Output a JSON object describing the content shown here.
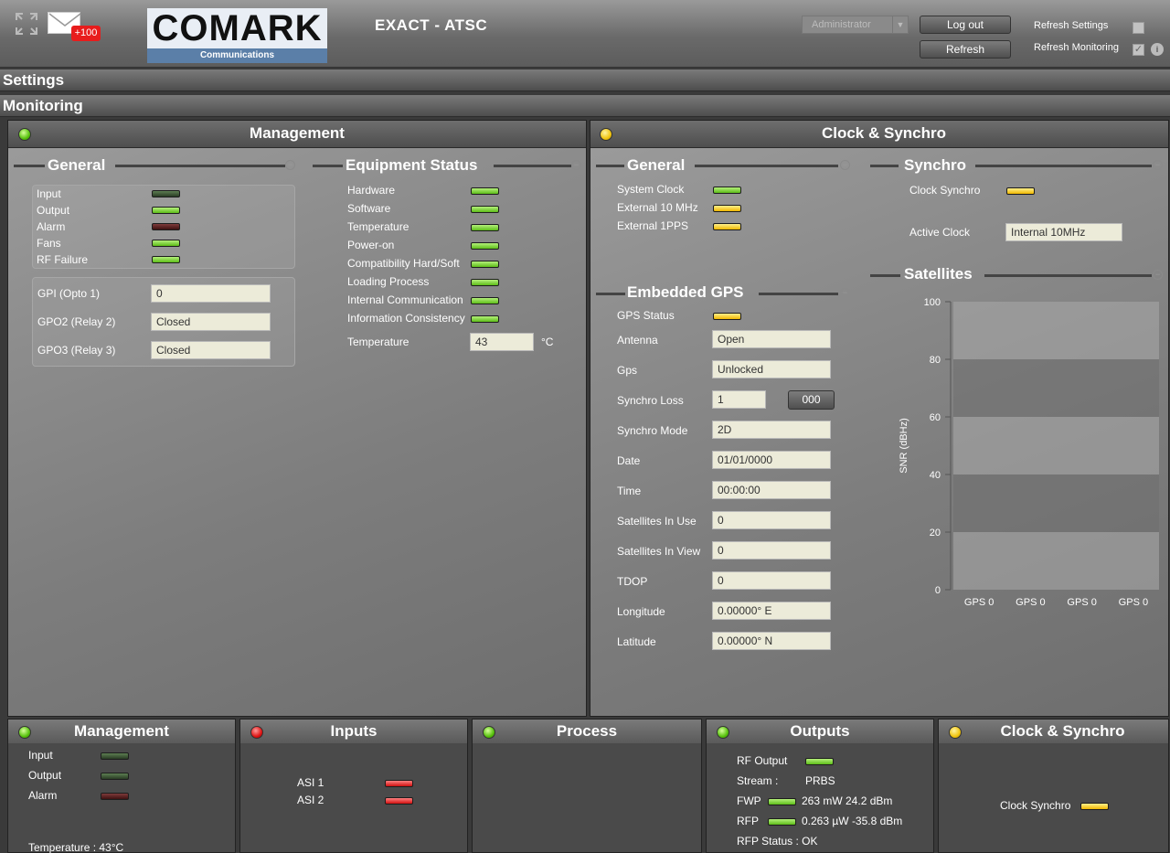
{
  "header": {
    "mail_badge": "+100",
    "logo_top": "COMARK",
    "logo_bottom": "Communications",
    "title": "EXACT  - ATSC",
    "user_role": "Administrator",
    "logout_label": "Log out",
    "refresh_label": "Refresh",
    "refresh_settings_label": "Refresh Settings",
    "refresh_monitoring_label": "Refresh Monitoring",
    "refresh_settings_checked": false,
    "refresh_monitoring_checked": true
  },
  "nav": {
    "settings": "Settings",
    "monitoring": "Monitoring"
  },
  "management": {
    "title": "Management",
    "status": "green",
    "general": {
      "title": "General",
      "indicators": [
        {
          "label": "Input",
          "state": "dark-green"
        },
        {
          "label": "Output",
          "state": "green"
        },
        {
          "label": "Alarm",
          "state": "dark-red"
        },
        {
          "label": "Fans",
          "state": "green"
        },
        {
          "label": "RF Failure",
          "state": "green"
        }
      ],
      "fields": [
        {
          "label": "GPI (Opto 1)",
          "value": "0"
        },
        {
          "label": "GPO2 (Relay 2)",
          "value": "Closed"
        },
        {
          "label": "GPO3 (Relay 3)",
          "value": "Closed"
        }
      ]
    },
    "equipment": {
      "title": "Equipment Status",
      "indicators": [
        {
          "label": "Hardware",
          "state": "green"
        },
        {
          "label": "Software",
          "state": "green"
        },
        {
          "label": "Temperature",
          "state": "green"
        },
        {
          "label": "Power-on",
          "state": "green"
        },
        {
          "label": "Compatibility Hard/Soft",
          "state": "green"
        },
        {
          "label": "Loading Process",
          "state": "green"
        },
        {
          "label": "Internal Communication",
          "state": "green"
        },
        {
          "label": "Information Consistency",
          "state": "green"
        }
      ],
      "temperature_label": "Temperature",
      "temperature_value": "43",
      "temperature_unit": "°C"
    }
  },
  "clock": {
    "title": "Clock & Synchro",
    "status": "yellow",
    "general": {
      "title": "General",
      "indicators": [
        {
          "label": "System Clock",
          "state": "green"
        },
        {
          "label": "External 10 MHz",
          "state": "yellow"
        },
        {
          "label": "External 1PPS",
          "state": "yellow"
        }
      ]
    },
    "synchro": {
      "title": "Synchro",
      "clock_synchro_label": "Clock Synchro",
      "clock_synchro_state": "yellow",
      "active_clock_label": "Active Clock",
      "active_clock_value": "Internal 10MHz"
    },
    "gps": {
      "title": "Embedded GPS",
      "status_label": "GPS Status",
      "status_state": "yellow",
      "fields": [
        {
          "label": "Antenna",
          "value": "Open"
        },
        {
          "label": "Gps",
          "value": "Unlocked"
        },
        {
          "label": "Synchro Loss",
          "value": "1"
        },
        {
          "label": "Synchro Mode",
          "value": "2D"
        },
        {
          "label": "Date",
          "value": "01/01/0000"
        },
        {
          "label": "Time",
          "value": "00:00:00"
        },
        {
          "label": "Satellites In Use",
          "value": "0"
        },
        {
          "label": "Satellites In View",
          "value": "0"
        },
        {
          "label": "TDOP",
          "value": "0"
        },
        {
          "label": "Longitude",
          "value": "0.00000° E"
        },
        {
          "label": "Latitude",
          "value": "0.00000° N"
        }
      ],
      "reset_button": "000"
    },
    "satellites": {
      "title": "Satellites"
    }
  },
  "chart_data": {
    "type": "bar",
    "categories": [
      "GPS 0",
      "GPS 0",
      "GPS 0",
      "GPS 0"
    ],
    "values": [
      0,
      0,
      0,
      0
    ],
    "ylabel": "SNR (dBHz)",
    "ylim": [
      0,
      100
    ],
    "yticks": [
      0,
      20,
      40,
      60,
      80,
      100
    ],
    "grid": "alternating bands"
  },
  "bottom": {
    "management": {
      "title": "Management",
      "status": "green",
      "indicators": [
        {
          "label": "Input",
          "state": "dark-green"
        },
        {
          "label": "Output",
          "state": "dark-green"
        },
        {
          "label": "Alarm",
          "state": "dark-red"
        }
      ],
      "temperature": "Temperature :  43°C"
    },
    "inputs": {
      "title": "Inputs",
      "status": "red",
      "indicators": [
        {
          "label": "ASI 1",
          "state": "red"
        },
        {
          "label": "ASI 2",
          "state": "red"
        }
      ]
    },
    "process": {
      "title": "Process",
      "status": "green"
    },
    "outputs": {
      "title": "Outputs",
      "status": "green",
      "rf_output_label": "RF Output",
      "stream_label": "Stream :",
      "stream_value": "PRBS",
      "fwp_label": "FWP",
      "fwp_value": "263 mW  24.2 dBm",
      "rfp_label": "RFP",
      "rfp_value": "0.263 µW  -35.8 dBm",
      "rfp_status": "RFP Status :  OK"
    },
    "clock": {
      "title": "Clock & Synchro",
      "status": "yellow",
      "clock_synchro_label": "Clock Synchro"
    }
  }
}
